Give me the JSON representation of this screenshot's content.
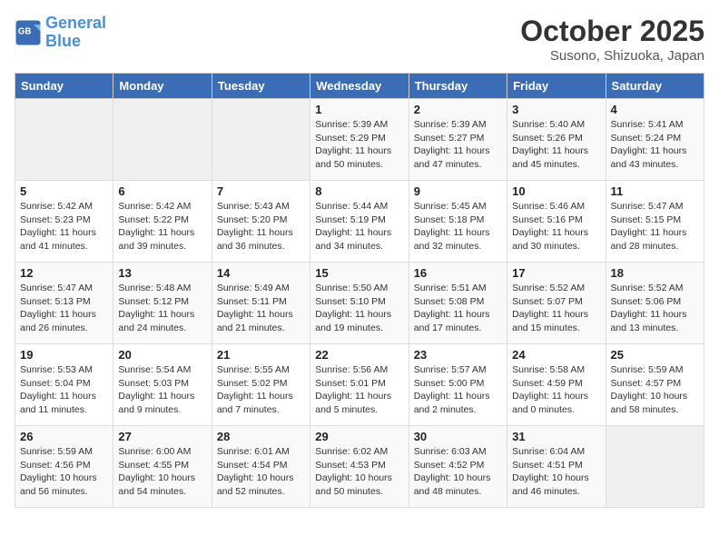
{
  "header": {
    "logo_line1": "General",
    "logo_line2": "Blue",
    "month": "October 2025",
    "location": "Susono, Shizuoka, Japan"
  },
  "weekdays": [
    "Sunday",
    "Monday",
    "Tuesday",
    "Wednesday",
    "Thursday",
    "Friday",
    "Saturday"
  ],
  "weeks": [
    [
      {
        "day": "",
        "info": ""
      },
      {
        "day": "",
        "info": ""
      },
      {
        "day": "",
        "info": ""
      },
      {
        "day": "1",
        "info": "Sunrise: 5:39 AM\nSunset: 5:29 PM\nDaylight: 11 hours\nand 50 minutes."
      },
      {
        "day": "2",
        "info": "Sunrise: 5:39 AM\nSunset: 5:27 PM\nDaylight: 11 hours\nand 47 minutes."
      },
      {
        "day": "3",
        "info": "Sunrise: 5:40 AM\nSunset: 5:26 PM\nDaylight: 11 hours\nand 45 minutes."
      },
      {
        "day": "4",
        "info": "Sunrise: 5:41 AM\nSunset: 5:24 PM\nDaylight: 11 hours\nand 43 minutes."
      }
    ],
    [
      {
        "day": "5",
        "info": "Sunrise: 5:42 AM\nSunset: 5:23 PM\nDaylight: 11 hours\nand 41 minutes."
      },
      {
        "day": "6",
        "info": "Sunrise: 5:42 AM\nSunset: 5:22 PM\nDaylight: 11 hours\nand 39 minutes."
      },
      {
        "day": "7",
        "info": "Sunrise: 5:43 AM\nSunset: 5:20 PM\nDaylight: 11 hours\nand 36 minutes."
      },
      {
        "day": "8",
        "info": "Sunrise: 5:44 AM\nSunset: 5:19 PM\nDaylight: 11 hours\nand 34 minutes."
      },
      {
        "day": "9",
        "info": "Sunrise: 5:45 AM\nSunset: 5:18 PM\nDaylight: 11 hours\nand 32 minutes."
      },
      {
        "day": "10",
        "info": "Sunrise: 5:46 AM\nSunset: 5:16 PM\nDaylight: 11 hours\nand 30 minutes."
      },
      {
        "day": "11",
        "info": "Sunrise: 5:47 AM\nSunset: 5:15 PM\nDaylight: 11 hours\nand 28 minutes."
      }
    ],
    [
      {
        "day": "12",
        "info": "Sunrise: 5:47 AM\nSunset: 5:13 PM\nDaylight: 11 hours\nand 26 minutes."
      },
      {
        "day": "13",
        "info": "Sunrise: 5:48 AM\nSunset: 5:12 PM\nDaylight: 11 hours\nand 24 minutes."
      },
      {
        "day": "14",
        "info": "Sunrise: 5:49 AM\nSunset: 5:11 PM\nDaylight: 11 hours\nand 21 minutes."
      },
      {
        "day": "15",
        "info": "Sunrise: 5:50 AM\nSunset: 5:10 PM\nDaylight: 11 hours\nand 19 minutes."
      },
      {
        "day": "16",
        "info": "Sunrise: 5:51 AM\nSunset: 5:08 PM\nDaylight: 11 hours\nand 17 minutes."
      },
      {
        "day": "17",
        "info": "Sunrise: 5:52 AM\nSunset: 5:07 PM\nDaylight: 11 hours\nand 15 minutes."
      },
      {
        "day": "18",
        "info": "Sunrise: 5:52 AM\nSunset: 5:06 PM\nDaylight: 11 hours\nand 13 minutes."
      }
    ],
    [
      {
        "day": "19",
        "info": "Sunrise: 5:53 AM\nSunset: 5:04 PM\nDaylight: 11 hours\nand 11 minutes."
      },
      {
        "day": "20",
        "info": "Sunrise: 5:54 AM\nSunset: 5:03 PM\nDaylight: 11 hours\nand 9 minutes."
      },
      {
        "day": "21",
        "info": "Sunrise: 5:55 AM\nSunset: 5:02 PM\nDaylight: 11 hours\nand 7 minutes."
      },
      {
        "day": "22",
        "info": "Sunrise: 5:56 AM\nSunset: 5:01 PM\nDaylight: 11 hours\nand 5 minutes."
      },
      {
        "day": "23",
        "info": "Sunrise: 5:57 AM\nSunset: 5:00 PM\nDaylight: 11 hours\nand 2 minutes."
      },
      {
        "day": "24",
        "info": "Sunrise: 5:58 AM\nSunset: 4:59 PM\nDaylight: 11 hours\nand 0 minutes."
      },
      {
        "day": "25",
        "info": "Sunrise: 5:59 AM\nSunset: 4:57 PM\nDaylight: 10 hours\nand 58 minutes."
      }
    ],
    [
      {
        "day": "26",
        "info": "Sunrise: 5:59 AM\nSunset: 4:56 PM\nDaylight: 10 hours\nand 56 minutes."
      },
      {
        "day": "27",
        "info": "Sunrise: 6:00 AM\nSunset: 4:55 PM\nDaylight: 10 hours\nand 54 minutes."
      },
      {
        "day": "28",
        "info": "Sunrise: 6:01 AM\nSunset: 4:54 PM\nDaylight: 10 hours\nand 52 minutes."
      },
      {
        "day": "29",
        "info": "Sunrise: 6:02 AM\nSunset: 4:53 PM\nDaylight: 10 hours\nand 50 minutes."
      },
      {
        "day": "30",
        "info": "Sunrise: 6:03 AM\nSunset: 4:52 PM\nDaylight: 10 hours\nand 48 minutes."
      },
      {
        "day": "31",
        "info": "Sunrise: 6:04 AM\nSunset: 4:51 PM\nDaylight: 10 hours\nand 46 minutes."
      },
      {
        "day": "",
        "info": ""
      }
    ]
  ]
}
